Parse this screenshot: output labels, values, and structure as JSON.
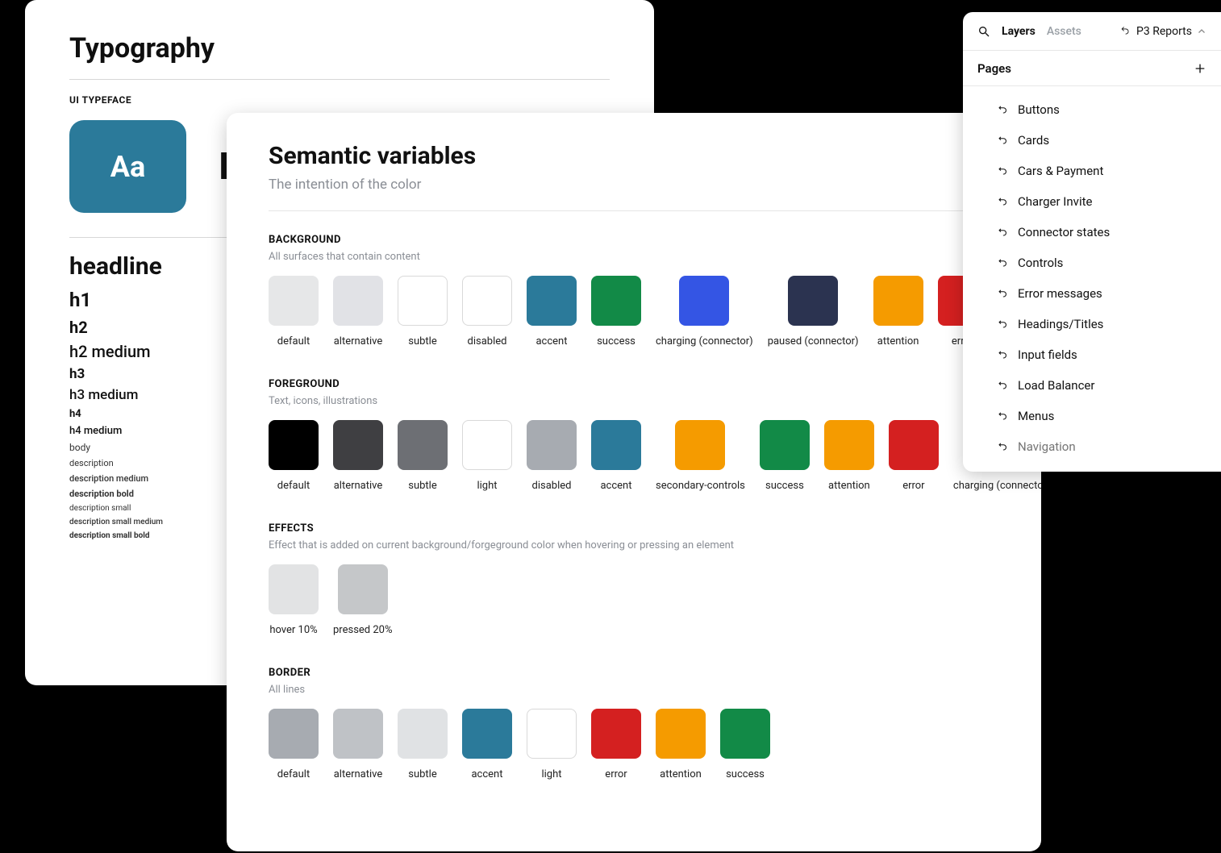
{
  "typography": {
    "title": "Typography",
    "subheading": "UI TYPEFACE",
    "aa_tile": "Aa",
    "typeface_name": "In",
    "styles": {
      "headline": "headline",
      "h1": "h1",
      "h2": "h2",
      "h2m": "h2 medium",
      "h3": "h3",
      "h3m": "h3 medium",
      "h4": "h4",
      "h4m": "h4 medium",
      "body": "body",
      "desc": "description",
      "descm": "description medium",
      "descb": "description bold",
      "descs": "description small",
      "descsm": "description small medium",
      "descsb": "description small bold"
    }
  },
  "semantic": {
    "title": "Semantic variables",
    "caption": "The intention of the color",
    "sections": {
      "background": {
        "title": "BACKGROUND",
        "desc": "All surfaces that contain content",
        "swatches": [
          {
            "label": "default",
            "color": "#e6e7e8",
            "outline": false
          },
          {
            "label": "alternative",
            "color": "#e1e2e6",
            "outline": false
          },
          {
            "label": "subtle",
            "color": "#ffffff",
            "outline": true
          },
          {
            "label": "disabled",
            "color": "#ffffff",
            "outline": true
          },
          {
            "label": "accent",
            "color": "#2b7a9a",
            "outline": false
          },
          {
            "label": "success",
            "color": "#128a47",
            "outline": false
          },
          {
            "label": "charging (connector)",
            "color": "#3455e4",
            "outline": false
          },
          {
            "label": "paused (connector)",
            "color": "#2b3350",
            "outline": false
          },
          {
            "label": "attention",
            "color": "#f59b00",
            "outline": false
          },
          {
            "label": "error",
            "color": "#d42020",
            "outline": false
          }
        ]
      },
      "foreground": {
        "title": "FOREGROUND",
        "desc": "Text, icons, illustrations",
        "swatches": [
          {
            "label": "default",
            "color": "#000000",
            "outline": false
          },
          {
            "label": "alternative",
            "color": "#3f3f42",
            "outline": false
          },
          {
            "label": "subtle",
            "color": "#6d6f74",
            "outline": false
          },
          {
            "label": "light",
            "color": "#ffffff",
            "outline": true
          },
          {
            "label": "disabled",
            "color": "#a7abb1",
            "outline": false
          },
          {
            "label": "accent",
            "color": "#2b7a9a",
            "outline": false
          },
          {
            "label": "secondary-controls",
            "color": "#f59b00",
            "outline": false
          },
          {
            "label": "success",
            "color": "#128a47",
            "outline": false
          },
          {
            "label": "attention",
            "color": "#f59b00",
            "outline": false
          },
          {
            "label": "error",
            "color": "#d42020",
            "outline": false
          },
          {
            "label": "charging (connector)",
            "color": "#3455e4",
            "outline": false
          }
        ]
      },
      "effects": {
        "title": "EFFECTS",
        "desc": "Effect that is added on current background/forgeground color when hovering or pressing an element",
        "swatches": [
          {
            "label": "hover 10%",
            "color": "#e2e3e4",
            "outline": false
          },
          {
            "label": "pressed 20%",
            "color": "#c5c7c9",
            "outline": false
          }
        ]
      },
      "border": {
        "title": "BORDER",
        "desc": "All lines",
        "swatches": [
          {
            "label": "default",
            "color": "#a7abb1",
            "outline": false
          },
          {
            "label": "alternative",
            "color": "#bfc2c6",
            "outline": false
          },
          {
            "label": "subtle",
            "color": "#e0e2e4",
            "outline": false
          },
          {
            "label": "accent",
            "color": "#2b7a9a",
            "outline": false
          },
          {
            "label": "light",
            "color": "#ffffff",
            "outline": true
          },
          {
            "label": "error",
            "color": "#d42020",
            "outline": false
          },
          {
            "label": "attention",
            "color": "#f59b00",
            "outline": false
          },
          {
            "label": "success",
            "color": "#128a47",
            "outline": false
          }
        ]
      }
    }
  },
  "panel": {
    "tabs": {
      "layers": "Layers",
      "assets": "Assets"
    },
    "project": "P3 Reports",
    "pages_label": "Pages",
    "pages": [
      "Buttons",
      "Cards",
      "Cars & Payment",
      "Charger Invite",
      "Connector states",
      "Controls",
      "Error messages",
      "Headings/Titles",
      "Input fields",
      "Load Balancer",
      "Menus",
      "Navigation"
    ]
  }
}
